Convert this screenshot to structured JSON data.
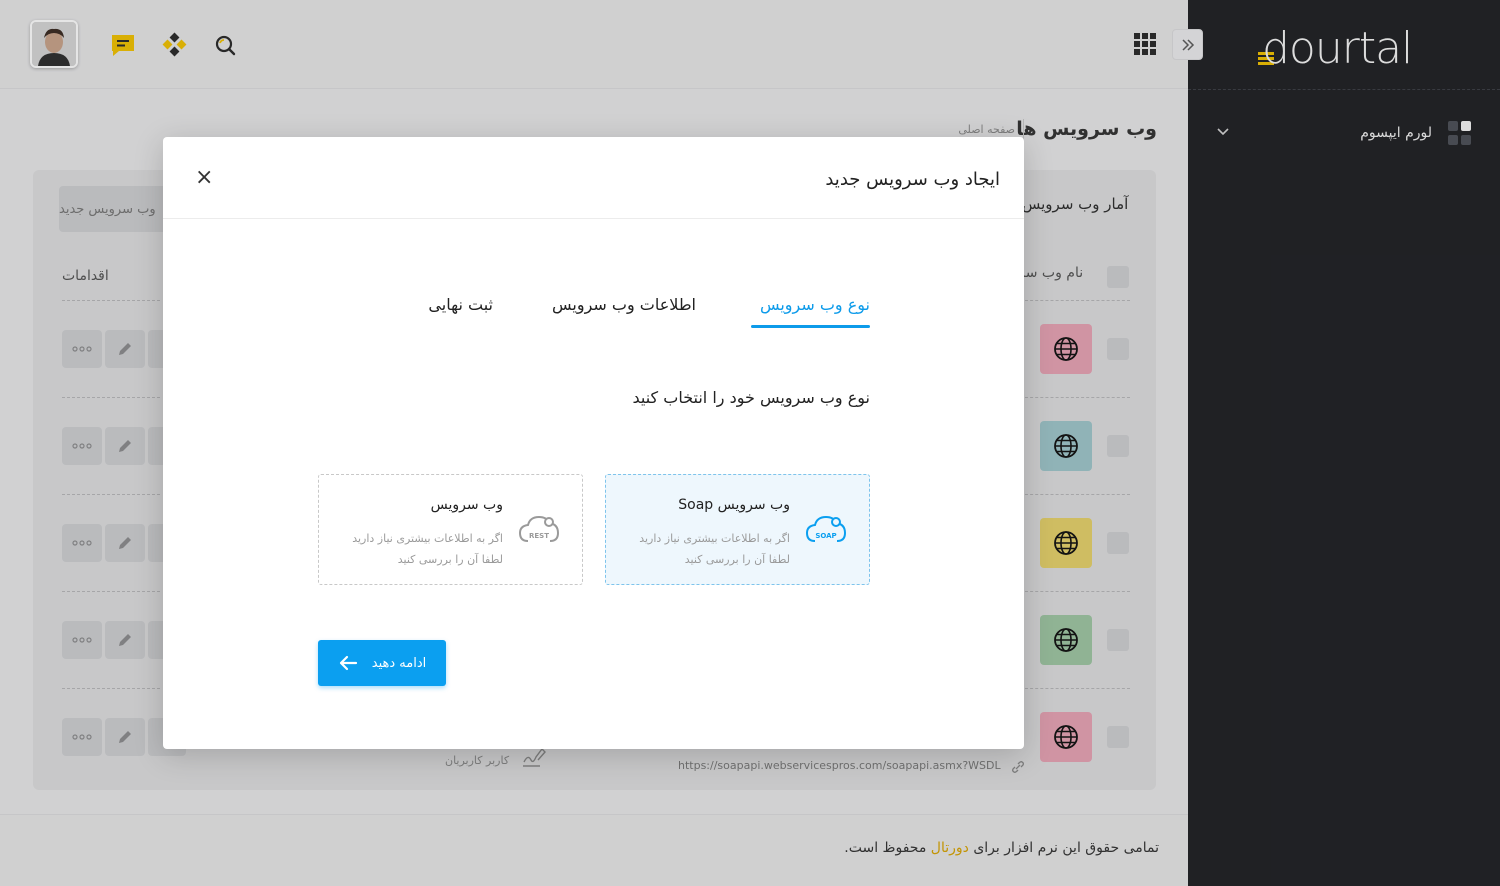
{
  "brand": {
    "logo_text": "dourtal",
    "accent": "#f2c200"
  },
  "sidebar": {
    "item_label": "لورم ایپسوم"
  },
  "header": {
    "icons": [
      "avatar",
      "chat-icon",
      "diamond-icon",
      "search-icon",
      "apps-grid-icon",
      "collapse-sidebar-icon"
    ]
  },
  "page": {
    "title": "وب سرویس ها",
    "breadcrumb": "صفحه اصلی",
    "new_button": "وب سرویس جدید",
    "stats_title": "آمار وب سرویس",
    "columns": {
      "name": "نام وب سر",
      "actions": "اقدامات"
    },
    "row_colors": [
      "#e8a3b4",
      "#9fc7cb",
      "#e6d26a",
      "#9fc7a3",
      "#e8a3b4"
    ],
    "row_url": "https://soapapi.webservicespros.com/soapapi.asmx?WSDL",
    "row_user": "کاربر کاربریان",
    "action_icons": [
      "more-icon",
      "edit-icon"
    ]
  },
  "footer": {
    "text_before": "تمامی حقوق این نرم افزار برای ",
    "brand": "دورتال",
    "text_after": " محفوظ است."
  },
  "modal": {
    "title": "ایجاد وب سرویس جدید",
    "close_symbol": "×",
    "tabs": [
      {
        "label": "نوع وب سرویس",
        "active": true
      },
      {
        "label": "اطلاعات وب سرویس",
        "active": false
      },
      {
        "label": "ثبت نهایی",
        "active": false
      }
    ],
    "section_label": "نوع وب سرویس خود را انتخاب کنید",
    "options": [
      {
        "title": "وب سرویس Soap",
        "desc_line1": "اگر به اطلاعات بیشتری نیاز دارید",
        "desc_line2": "لطفا آن را بررسی کنید",
        "icon_label": "SOAP",
        "selected": true
      },
      {
        "title": "وب سرویس",
        "desc_line1": "اگر به اطلاعات بیشتری نیاز دارید",
        "desc_line2": "لطفا آن را بررسی کنید",
        "icon_label": "REST",
        "selected": false
      }
    ],
    "continue_label": "ادامه دهید",
    "accent": "#0b9ff0"
  }
}
